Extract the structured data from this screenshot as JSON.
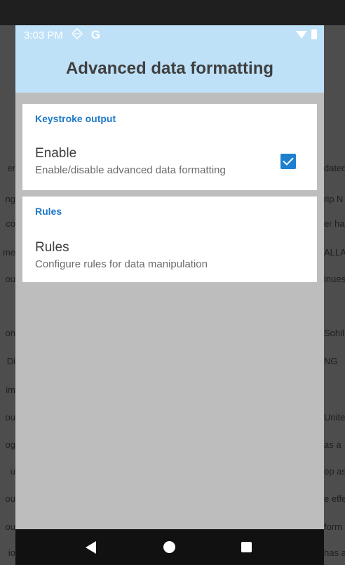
{
  "status_bar": {
    "time": "3:03 PM",
    "left_icons": [
      "sync-diamond-icon",
      "google-icon"
    ],
    "google_glyph": "G",
    "right_icons": [
      "wifi-icon",
      "battery-icon"
    ]
  },
  "app_bar": {
    "title": "Advanced data formatting"
  },
  "sections": [
    {
      "header": "Keystroke output",
      "item": {
        "title": "Enable",
        "summary": "Enable/disable advanced data formatting",
        "checked": true
      }
    },
    {
      "header": "Rules",
      "item": {
        "title": "Rules",
        "summary": "Configure rules for data manipulation"
      }
    }
  ],
  "background_fragments": {
    "left": [
      "er",
      "ng",
      "co",
      "me",
      "ou",
      "on",
      "Di",
      "im",
      "ou",
      "og",
      "u",
      "ou",
      "ou",
      "io"
    ],
    "right": [
      "dated",
      "rip N",
      "er ha",
      "ALLA",
      "inues",
      "Sohil,",
      "NG",
      "Unite",
      "as a",
      "op as",
      "e effe",
      "form",
      "has a"
    ]
  },
  "navigation_bar": {
    "buttons": [
      "back",
      "home",
      "recents"
    ]
  },
  "colors": {
    "app_bar": "#bfe1f8",
    "accent": "#1e7fd1",
    "section_header": "#1e78c8",
    "content_bg": "#bdbdbd"
  }
}
